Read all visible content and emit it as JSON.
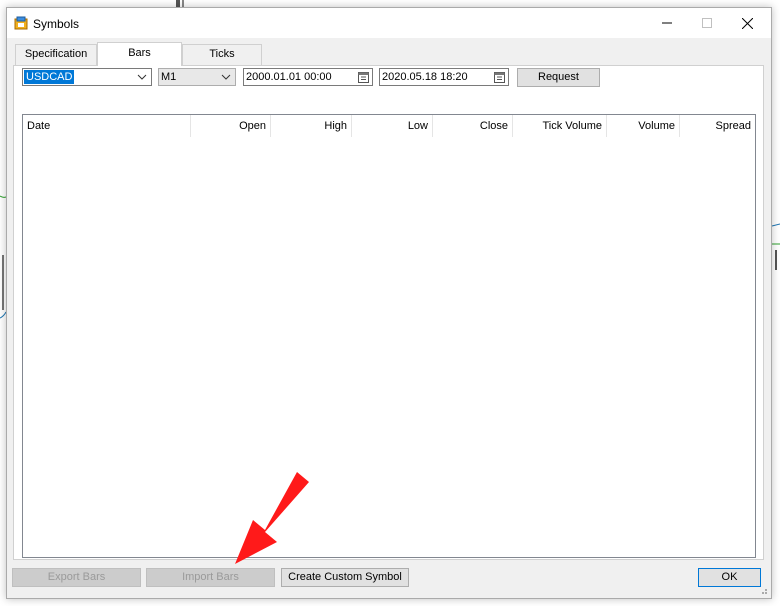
{
  "window": {
    "title": "Symbols"
  },
  "tabs": [
    {
      "label": "Specification",
      "active": false
    },
    {
      "label": "Bars",
      "active": true
    },
    {
      "label": "Ticks",
      "active": false
    }
  ],
  "toolbar": {
    "symbol": "USDCAD",
    "timeframe": "M1",
    "date_from": "2000.01.01 00:00",
    "date_to": "2020.05.18 18:20",
    "request_label": "Request"
  },
  "grid": {
    "columns": [
      "Date",
      "Open",
      "High",
      "Low",
      "Close",
      "Tick Volume",
      "Volume",
      "Spread"
    ],
    "rows": []
  },
  "footer": {
    "export_label": "Export Bars",
    "import_label": "Import Bars",
    "create_label": "Create Custom Symbol",
    "ok_label": "OK"
  },
  "colors": {
    "accent": "#0078d7",
    "annotation_arrow": "#ff1a1a"
  }
}
